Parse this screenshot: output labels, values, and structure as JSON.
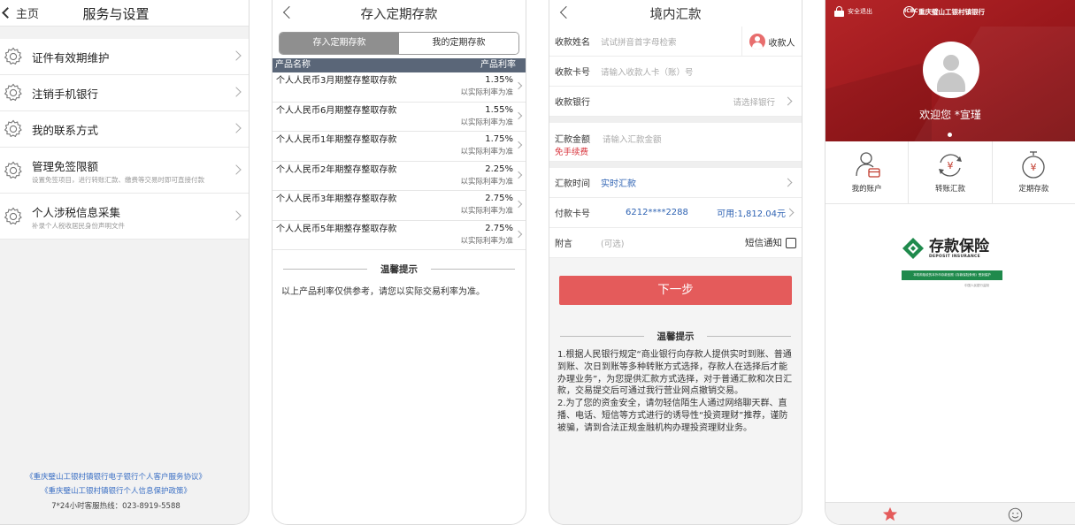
{
  "screen1": {
    "back_label": "主页",
    "title": "服务与设置",
    "items": [
      {
        "label": "证件有效期维护",
        "sub": ""
      },
      {
        "label": "注销手机银行",
        "sub": ""
      },
      {
        "label": "我的联系方式",
        "sub": ""
      },
      {
        "label": "管理免签限额",
        "sub": "设置免签项目，进行转账汇款、缴费等交易时即可直接付款"
      },
      {
        "label": "个人涉税信息采集",
        "sub": "补录个人税收居民身份声明文件"
      }
    ],
    "footer": {
      "link1": "《重庆璧山工银村镇银行电子银行个人客户服务协议》",
      "link2": "《重庆璧山工银村镇银行个人信息保护政策》",
      "hotline": "7*24小时客服热线：023-8919-5588"
    }
  },
  "screen2": {
    "title": "存入定期存款",
    "tabs": [
      "存入定期存款",
      "我的定期存款"
    ],
    "table_header": {
      "name": "产品名称",
      "rate": "产品利率"
    },
    "products": [
      {
        "name": "个人人民币3月期整存整取存款",
        "rate": "1.35%",
        "note": "以实际利率为准"
      },
      {
        "name": "个人人民币6月期整存整取存款",
        "rate": "1.55%",
        "note": "以实际利率为准"
      },
      {
        "name": "个人人民币1年期整存整取存款",
        "rate": "1.75%",
        "note": "以实际利率为准"
      },
      {
        "name": "个人人民币2年期整存整取存款",
        "rate": "2.25%",
        "note": "以实际利率为准"
      },
      {
        "name": "个人人民币3年期整存整取存款",
        "rate": "2.75%",
        "note": "以实际利率为准"
      },
      {
        "name": "个人人民币5年期整存整取存款",
        "rate": "2.75%",
        "note": "以实际利率为准"
      }
    ],
    "tip_title": "温馨提示",
    "tip_text": "以上产品利率仅供参考，请您以实际交易利率为准。"
  },
  "screen3": {
    "title": "境内汇款",
    "payee_name_label": "收款姓名",
    "payee_name_placeholder": "试试拼音首字母检索",
    "payee_button": "收款人",
    "card_label": "收款卡号",
    "card_placeholder": "请输入收款人卡（账）号",
    "bank_label": "收款银行",
    "bank_placeholder": "请选择银行",
    "amount_label": "汇款金额",
    "amount_fee": "免手续费",
    "amount_placeholder": "请输入汇款金额",
    "time_label": "汇款时间",
    "time_value": "实时汇款",
    "pay_card_label": "付款卡号",
    "pay_card_value": "6212****2288",
    "available": "可用:1,812.04元",
    "memo_label": "附言",
    "memo_placeholder": "(可选)",
    "sms_label": "短信通知",
    "next_button": "下一步",
    "tip_title": "温馨提示",
    "tip_text": "1.根据人民银行规定“商业银行向存款人提供实时到账、普通到账、次日到账等多种转账方式选择，存款人在选择后才能办理业务”，为您提供汇款方式选择，对于普通汇款和次日汇款，交易提交后可通过我行营业网点撤销交易。\n2.为了您的资金安全，请勿轻信陌生人通过网络聊天群、直播、电话、短信等方式进行的诱导性“投资理财”推荐，谨防被骗，请到合法正规金融机构办理投资理财业务。"
  },
  "screen4": {
    "logout": "安全退出",
    "bank_name": "重庆璧山工银村镇银行",
    "welcome": "欢迎您 *宣瑾",
    "menu": [
      {
        "label": "我的账户",
        "icon": "account-icon"
      },
      {
        "label": "转账汇款",
        "icon": "transfer-icon"
      },
      {
        "label": "定期存款",
        "icon": "deposit-icon"
      }
    ],
    "deposit_insurance_title": "存款保险",
    "deposit_insurance_sub": "DEPOSIT INSURANCE",
    "green_banner": "本机构吸收的本外币存款依照《存款保险条例》受到保护",
    "tiny_note": "中国人民银行监制",
    "colors": {
      "brand_red": "#a81e22",
      "accent_red": "#e45b5b",
      "link_blue": "#2f63b3",
      "green": "#1f8a4c"
    }
  }
}
